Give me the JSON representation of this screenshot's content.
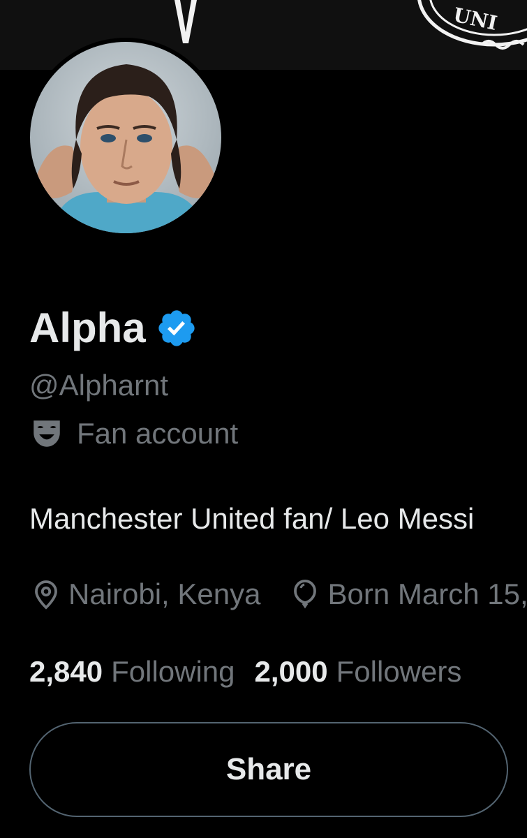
{
  "profile": {
    "display_name": "Alpha",
    "verified": true,
    "handle": "@Alpharnt",
    "category_label": "Fan account",
    "bio": "Manchester United fan/ Leo Messi",
    "location": "Nairobi, Kenya",
    "birthday": "Born March 15,",
    "following_count": "2,840",
    "following_label": "Following",
    "followers_count": "2,000",
    "followers_label": "Followers"
  },
  "actions": {
    "share_label": "Share"
  },
  "icons": {
    "verified": "verified-badge-icon",
    "category": "theater-mask-icon",
    "location": "location-pin-icon",
    "birthday": "balloon-icon"
  },
  "colors": {
    "background": "#000000",
    "primary_text": "#e7e9ea",
    "secondary_text": "#71767b",
    "verified_blue": "#1d9bf0",
    "button_border": "#536471"
  }
}
